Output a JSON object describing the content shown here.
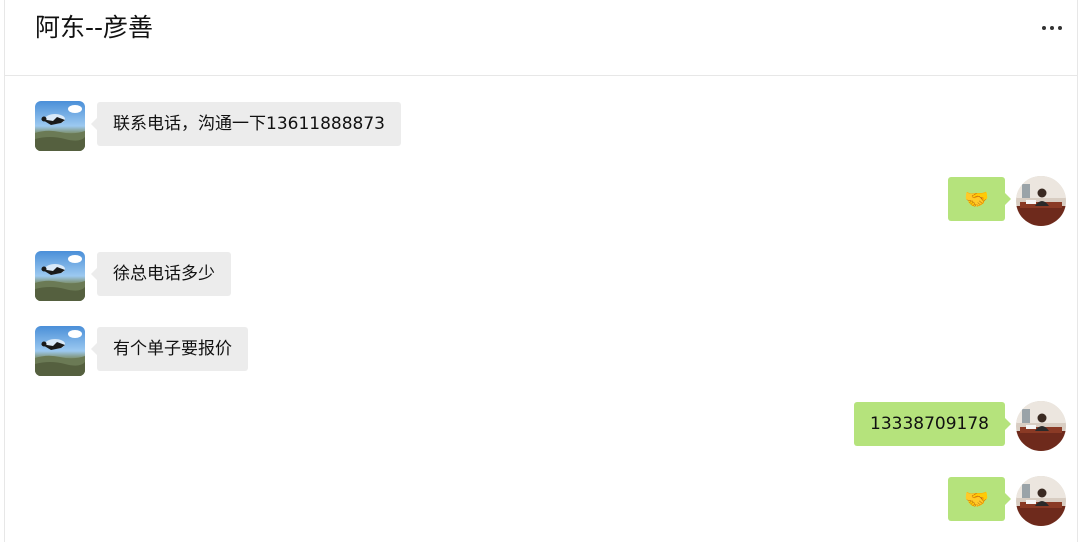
{
  "header": {
    "title": "阿东--彦善"
  },
  "contact_avatar_icon": "skydiver-landscape-avatar",
  "self_avatar_icon": "person-at-desk-avatar",
  "colors": {
    "incoming_bubble": "#ececec",
    "outgoing_bubble": "#b5e37c"
  },
  "messages": [
    {
      "direction": "incoming",
      "text": "联系电话，沟通一下13611888873"
    },
    {
      "direction": "outgoing",
      "text": "🤝"
    },
    {
      "direction": "incoming",
      "text": "徐总电话多少"
    },
    {
      "direction": "incoming",
      "text": "有个单子要报价"
    },
    {
      "direction": "outgoing",
      "text": "13338709178"
    },
    {
      "direction": "outgoing",
      "text": "🤝"
    }
  ]
}
